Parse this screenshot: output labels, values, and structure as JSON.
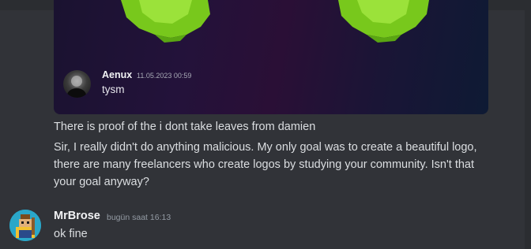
{
  "quoted_embed": {
    "author": "Aenux",
    "timestamp": "11.05.2023 00:59",
    "text": "tysm"
  },
  "messages": {
    "line1": "There is proof of the i dont take leaves from damien",
    "paragraph": [
      "Sir, I really didn't do anything malicious. My only goal was to create a beautiful logo,",
      "there are many freelancers who create logos by studying your community. Isn't that",
      "your goal anyway?"
    ]
  },
  "reply": {
    "author": "MrBrose",
    "timestamp": "bugün saat 16:13",
    "text": "ok fine"
  },
  "colors": {
    "background": "#313338",
    "accent_green": "#7ed321",
    "avatar_bg": "#2aa7c9"
  }
}
